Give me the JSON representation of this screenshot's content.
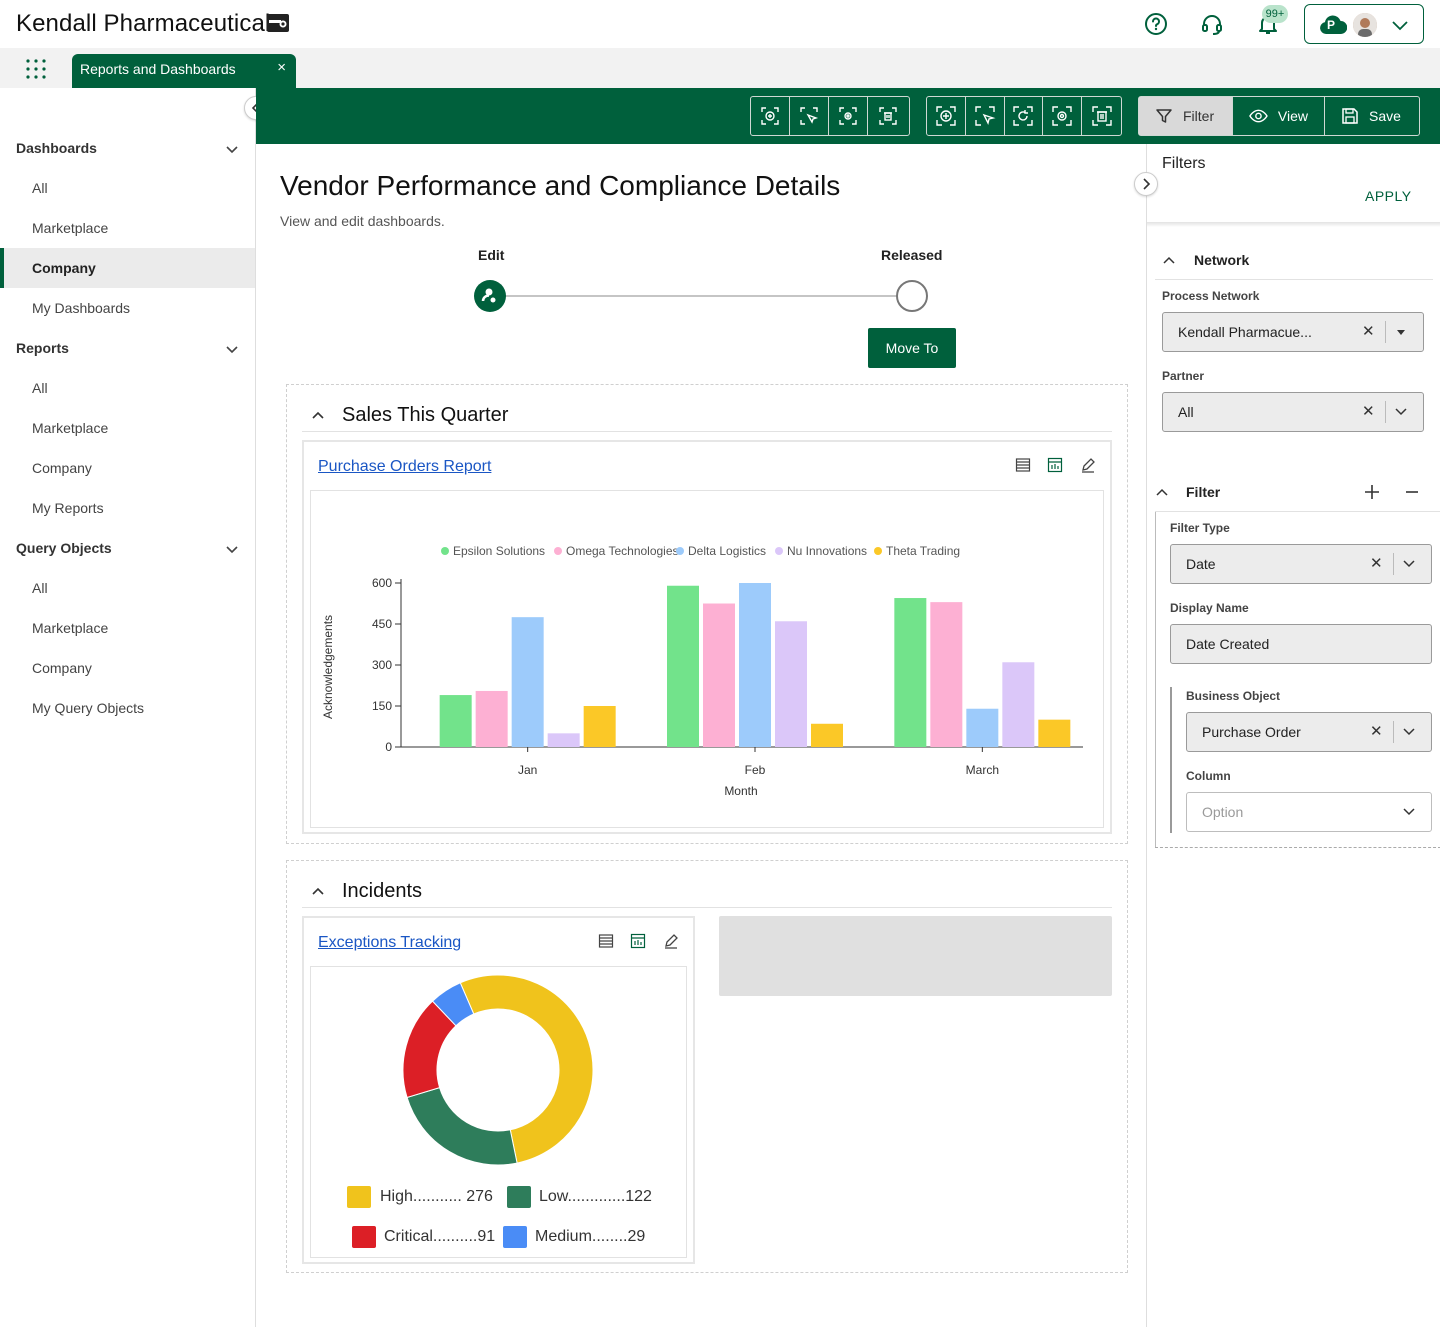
{
  "app": {
    "title": "Kendall Pharmaceuticals",
    "notification_count": "99+",
    "user_initial": "P"
  },
  "tab": {
    "label": "Reports and Dashboards",
    "close": "×"
  },
  "nav": {
    "sections": [
      {
        "title": "Dashboards",
        "items": [
          "All",
          "Marketplace",
          "Company",
          "My Dashboards"
        ],
        "active": "Company"
      },
      {
        "title": "Reports",
        "items": [
          "All",
          "Marketplace",
          "Company",
          "My Reports"
        ]
      },
      {
        "title": "Query Objects",
        "items": [
          "All",
          "Marketplace",
          "Company",
          "My Query Objects"
        ]
      }
    ]
  },
  "toolbar": {
    "filter_label": "Filter",
    "view_label": "View",
    "save_label": "Save"
  },
  "page": {
    "title": "Vendor Performance and Compliance Details",
    "subtitle": "View and edit dashboards.",
    "workflow": {
      "step1": "Edit",
      "step2": "Released",
      "move_label": "Move To"
    }
  },
  "sections": {
    "sales": {
      "title": "Sales This Quarter",
      "report_link": "Purchase Orders Report"
    },
    "incidents": {
      "title": "Incidents",
      "report_link": "Exceptions Tracking"
    }
  },
  "bar_chart": {
    "chart_data": {
      "type": "bar",
      "categories": [
        "Jan",
        "Feb",
        "March"
      ],
      "series": [
        {
          "name": "Epsilon Solutions",
          "color": "#72e38b",
          "values": [
            190,
            590,
            545
          ]
        },
        {
          "name": "Omega Technologies",
          "color": "#fdb0d3",
          "values": [
            205,
            525,
            530
          ]
        },
        {
          "name": "Delta Logistics",
          "color": "#9dcbfb",
          "values": [
            475,
            600,
            140
          ]
        },
        {
          "name": "Nu Innovations",
          "color": "#dbc7f9",
          "values": [
            50,
            460,
            310
          ]
        },
        {
          "name": "Theta Trading",
          "color": "#fbc827",
          "values": [
            150,
            85,
            100
          ]
        }
      ],
      "xlabel": "Month",
      "ylabel": "Acknowledgements",
      "yticks": [
        "0",
        "150",
        "300",
        "450",
        "600"
      ],
      "ylim": [
        0,
        600
      ]
    }
  },
  "donut_chart": {
    "chart_data": {
      "type": "pie",
      "slices": [
        {
          "label": "High",
          "value": 276,
          "color": "#f0c31c",
          "legend": "High........... 276"
        },
        {
          "label": "Low",
          "value": 122,
          "color": "#2e7d5b",
          "legend": "Low.............122"
        },
        {
          "label": "Critical",
          "value": 91,
          "color": "#dc1f26",
          "legend": "Critical..........91"
        },
        {
          "label": "Medium",
          "value": 29,
          "color": "#4a8cf6",
          "legend": "Medium........29"
        }
      ]
    }
  },
  "filters": {
    "title": "Filters",
    "apply_label": "APPLY",
    "network": {
      "title": "Network",
      "process_network_label": "Process Network",
      "process_network_value": "Kendall Pharmacue...",
      "partner_label": "Partner",
      "partner_value": "All"
    },
    "filter": {
      "title": "Filter",
      "filter_type_label": "Filter Type",
      "filter_type_value": "Date",
      "display_name_label": "Display Name",
      "display_name_value": "Date Created",
      "business_object_label": "Business Object",
      "business_object_value": "Purchase Order",
      "column_label": "Column",
      "column_placeholder": "Option"
    }
  }
}
